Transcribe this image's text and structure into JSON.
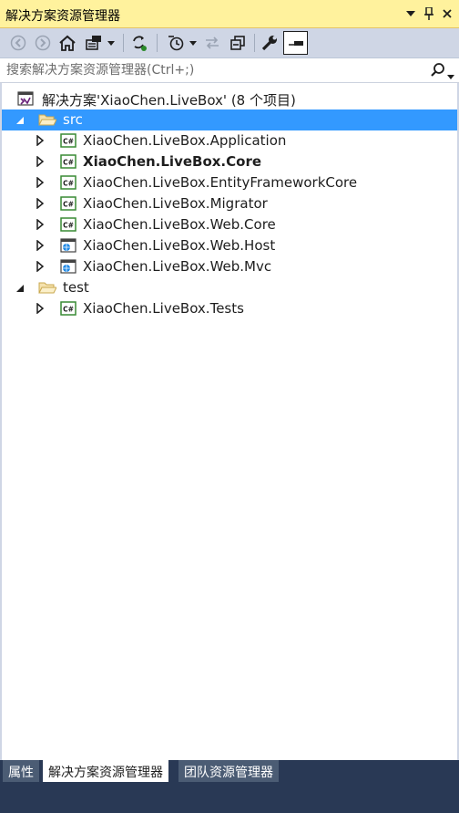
{
  "window": {
    "title": "解决方案资源管理器",
    "menu_icon": "dropdown-arrow-icon",
    "pin_icon": "pin-icon",
    "close_icon": "close-icon"
  },
  "toolbar": {
    "buttons": [
      "back-icon",
      "forward-icon",
      "home-icon",
      "switch-views-icon",
      "dropdown-arrow-icon",
      "sync-with-active-document-icon",
      "pending-changes-filter-icon",
      "dropdown-arrow-icon",
      "refresh-icon",
      "collapse-all-icon",
      "properties-icon",
      "preview-selected-item-icon"
    ]
  },
  "search": {
    "placeholder": "搜索解决方案资源管理器(Ctrl+;)",
    "icon": "search-icon"
  },
  "tree": {
    "solution": "解决方案'XiaoChen.LiveBox' (8 个项目)",
    "folders": [
      {
        "name": "src",
        "projects": [
          {
            "name": "XiaoChen.LiveBox.Application",
            "type": "csharp"
          },
          {
            "name": "XiaoChen.LiveBox.Core",
            "type": "csharp",
            "startup": true
          },
          {
            "name": "XiaoChen.LiveBox.EntityFrameworkCore",
            "type": "csharp"
          },
          {
            "name": "XiaoChen.LiveBox.Migrator",
            "type": "csharp"
          },
          {
            "name": "XiaoChen.LiveBox.Web.Core",
            "type": "csharp"
          },
          {
            "name": "XiaoChen.LiveBox.Web.Host",
            "type": "web"
          },
          {
            "name": "XiaoChen.LiveBox.Web.Mvc",
            "type": "web"
          }
        ]
      },
      {
        "name": "test",
        "projects": [
          {
            "name": "XiaoChen.LiveBox.Tests",
            "type": "csharp"
          }
        ]
      }
    ]
  },
  "bottom_tabs": [
    "属性",
    "解决方案资源管理器",
    "团队资源管理器"
  ],
  "colors": {
    "title_bg": "#fff29d",
    "toolbar_bg": "#cfd6e5",
    "selection": "#3399ff",
    "frame": "#293955"
  }
}
